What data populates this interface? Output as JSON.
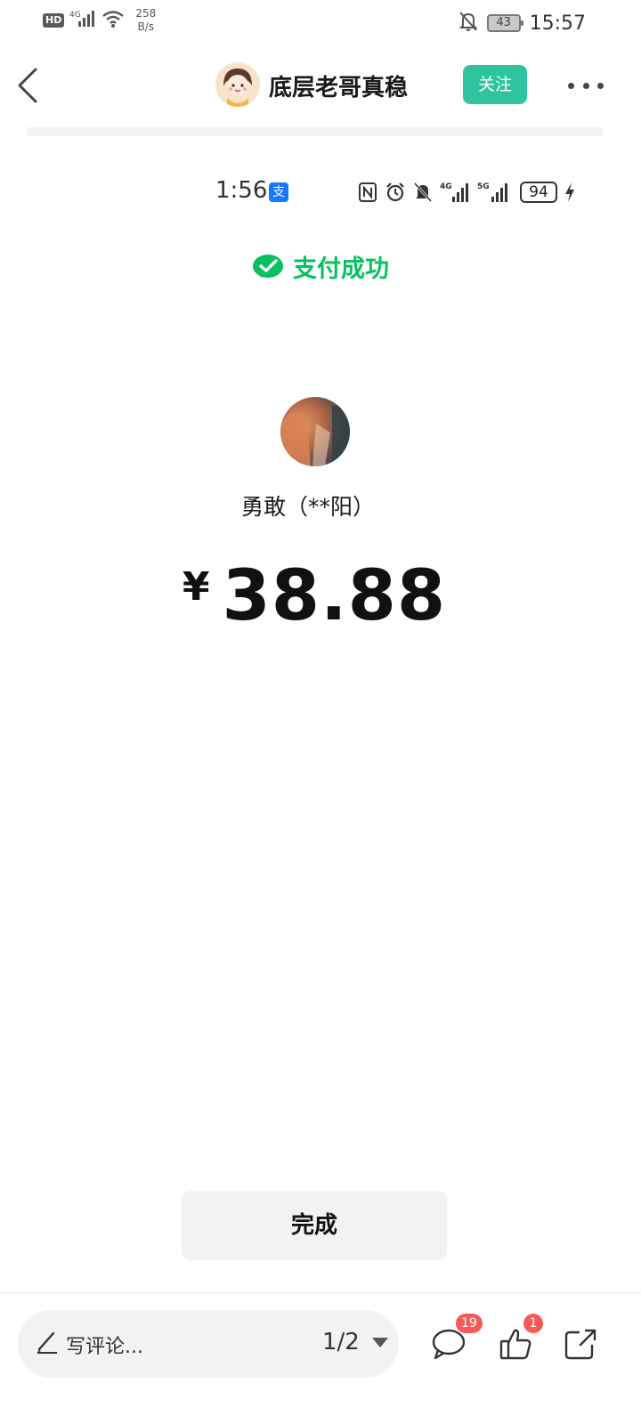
{
  "status_bar": {
    "hd_label": "HD",
    "network_label": "4G",
    "speed_value": "258",
    "speed_unit": "B/s",
    "battery_level": "43",
    "time": "15:57"
  },
  "header": {
    "author_name": "底层老哥真稳",
    "follow_label": "关注"
  },
  "inner_screenshot": {
    "status_time": "1:56",
    "alipay_char": "支",
    "battery_level": "94",
    "success_text": "支付成功",
    "payee_name": "勇敢（**阳）",
    "currency_symbol": "¥",
    "amount": "38.88",
    "done_label": "完成",
    "colors": {
      "success_green": "#07c160",
      "alipay_blue": "#1677ff"
    }
  },
  "bottom_bar": {
    "comment_placeholder": "写评论...",
    "page_indicator": "1/2",
    "comment_count": "19",
    "like_count": "1"
  },
  "colors": {
    "follow_button": "#2ec4a0",
    "badge": "#f55a5a"
  },
  "icons": {
    "back": "chevron-left-icon",
    "more": "more-dots-icon",
    "pencil": "pencil-icon",
    "comment": "comment-bubble-icon",
    "like": "thumbs-up-icon",
    "share": "share-icon"
  }
}
